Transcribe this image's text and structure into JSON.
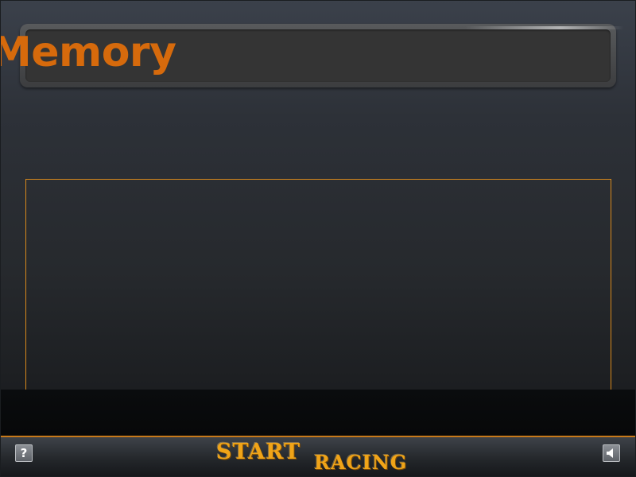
{
  "header": {
    "title": "Memory"
  },
  "footer": {
    "logo_word_1": "START",
    "logo_word_2": "RACING",
    "help_button_label": "?",
    "help_icon": "question-mark-icon",
    "sound_icon": "speaker-icon"
  },
  "colors": {
    "title_text": "#d66a0c",
    "accent_orange": "#d8891c",
    "logo_text": "#f0a418",
    "panel_bg": "#343434"
  }
}
